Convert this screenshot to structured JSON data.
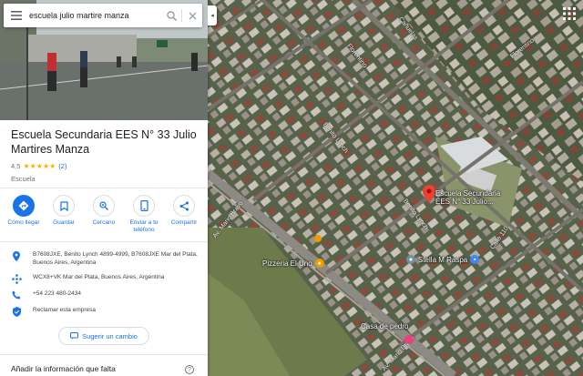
{
  "search": {
    "query": "escuela julio martire manza"
  },
  "place": {
    "title": "Escuela Secundaria EES N° 33 Julio Martires Manza",
    "rating": "4,5",
    "stars": "★★★★★",
    "review_count": "(2)",
    "category": "Escuela"
  },
  "actions": [
    {
      "label": "Cómo llegar",
      "icon": "directions-icon"
    },
    {
      "label": "Guardar",
      "icon": "bookmark-icon"
    },
    {
      "label": "Cercano",
      "icon": "nearby-icon"
    },
    {
      "label": "Enviar a tu teléfono",
      "icon": "send-to-phone-icon"
    },
    {
      "label": "Compartir",
      "icon": "share-icon"
    }
  ],
  "info": {
    "address": "B7608JXE, Benito Lynch 4899-4999, B7608JXE Mar del Plata, Buenos Aires, Argentina",
    "plus_code": "WCX8+VK Mar del Plata, Buenos Aires, Argentina",
    "phone": "+54 223 480-2434",
    "claim": "Reclamar esta empresa"
  },
  "suggest_label": "Sugerir un cambio",
  "add_info_label": "Añadir la información que falta",
  "help_icon": "?",
  "collapse_icon": "◂",
  "map": {
    "place_label": "Escuela Secundaria EES N° 33 Julio...",
    "pois": [
      {
        "label": "Pizzeria El Uno",
        "color": "#f29900"
      },
      {
        "label": "Stella M Raspa",
        "color": "#4285f4"
      },
      {
        "label": "Casa de pedro",
        "color": "#e9407f"
      }
    ],
    "streets": [
      "Av. Mario Bravo",
      "Av. Mario Bravo",
      "Benito Lynch",
      "Benito Lynch",
      "Calle 110",
      "Cañuelas",
      "Florentino",
      "Florentino"
    ]
  },
  "colors": {
    "accent": "#1a73e8",
    "pin": "#ea4335",
    "star": "#f4b400"
  }
}
